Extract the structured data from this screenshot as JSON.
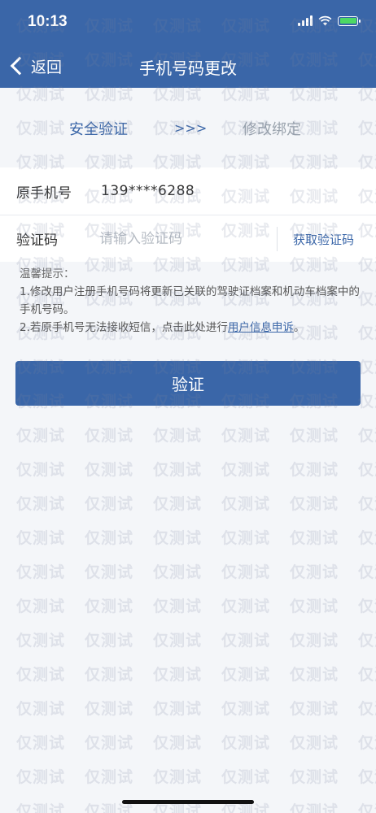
{
  "status_bar": {
    "time": "10:13"
  },
  "nav": {
    "back_label": "返回",
    "title": "手机号码更改"
  },
  "steps": {
    "step1": "安全验证",
    "arrow": ">>>",
    "step2": "修改绑定"
  },
  "form": {
    "phone_label": "原手机号",
    "phone_value": "139****6288",
    "code_label": "验证码",
    "code_placeholder": "请输入验证码",
    "get_code": "获取验证码"
  },
  "tips": {
    "title": "温馨提示：",
    "line1": "1.修改用户注册手机号码将更新已关联的驾驶证档案和机动车档案中的手机号码。",
    "line2_prefix": "2.若原手机号无法接收短信，点击此处进行",
    "line2_link": "用户信息申诉",
    "line2_suffix": "。"
  },
  "button": {
    "verify_label": "验证"
  },
  "watermark": {
    "text": "仅测试"
  },
  "colors": {
    "primary": "#3a66a8",
    "background": "#f4f6f9",
    "battery": "#4cd964"
  }
}
